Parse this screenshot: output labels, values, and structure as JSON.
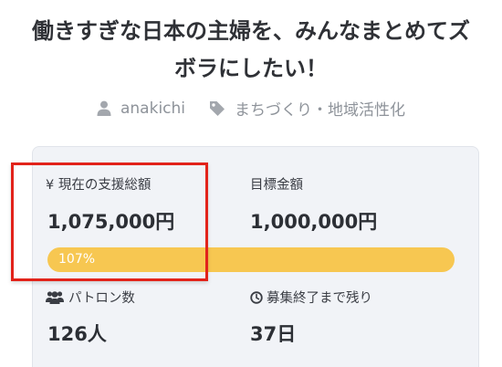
{
  "project": {
    "title_line1": "働きすぎな日本の主婦を、みんなまとめてズ",
    "title_line2": "ボラにしたい！",
    "author": "anakichi",
    "category": "まちづくり・地域活性化"
  },
  "stats": {
    "current_label": "¥ 現在の支援総額",
    "current_amount": "1,075,000円",
    "target_label": "目標金額",
    "target_amount": "1,000,000円",
    "progress_text": "107%",
    "progress_percent": 107,
    "patrons_label": "パトロン数",
    "patrons_value": "126人",
    "remaining_label": "募集終了まで残り",
    "remaining_value": "37日"
  },
  "colors": {
    "progress_bar": "#f7c751",
    "highlight_box": "#e2231a",
    "card_background": "#f1f3f7"
  },
  "icons": [
    "user-icon",
    "tag-icon",
    "users-icon",
    "clock-icon"
  ]
}
